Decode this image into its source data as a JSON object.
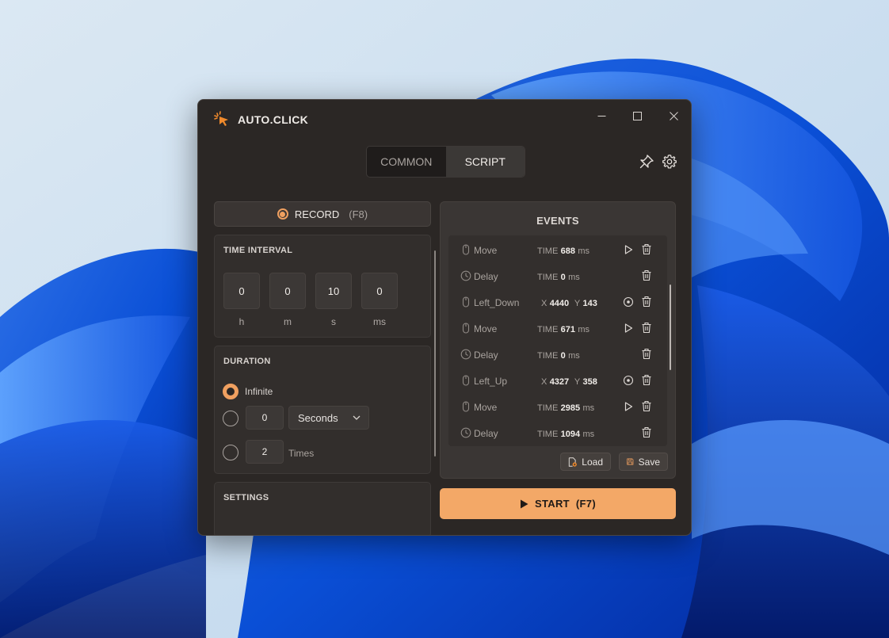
{
  "app": {
    "title": "AUTO.CLICK"
  },
  "tabs": [
    {
      "label": "COMMON",
      "active": false
    },
    {
      "label": "SCRIPT",
      "active": true
    }
  ],
  "record": {
    "label": "RECORD",
    "hotkey": "(F8)"
  },
  "time_interval": {
    "title": "TIME INTERVAL",
    "fields": [
      {
        "value": "0",
        "unit": "h"
      },
      {
        "value": "0",
        "unit": "m"
      },
      {
        "value": "10",
        "unit": "s"
      },
      {
        "value": "0",
        "unit": "ms"
      }
    ]
  },
  "duration": {
    "title": "DURATION",
    "selected": "infinite",
    "infinite_label": "Infinite",
    "seconds_value": "0",
    "seconds_unit": "Seconds",
    "times_value": "2",
    "times_label": "Times"
  },
  "settings": {
    "title": "SETTINGS"
  },
  "events": {
    "title": "EVENTS",
    "rows": [
      {
        "type": "mouse",
        "name": "Move",
        "kind": "time",
        "time": "688",
        "unit": "ms",
        "action": "play"
      },
      {
        "type": "clock",
        "name": "Delay",
        "kind": "time",
        "time": "0",
        "unit": "ms",
        "action": "none"
      },
      {
        "type": "mouse",
        "name": "Left_Down",
        "kind": "xy",
        "x": "4440",
        "y": "143",
        "action": "target"
      },
      {
        "type": "mouse",
        "name": "Move",
        "kind": "time",
        "time": "671",
        "unit": "ms",
        "action": "play"
      },
      {
        "type": "clock",
        "name": "Delay",
        "kind": "time",
        "time": "0",
        "unit": "ms",
        "action": "none"
      },
      {
        "type": "mouse",
        "name": "Left_Up",
        "kind": "xy",
        "x": "4327",
        "y": "358",
        "action": "target"
      },
      {
        "type": "mouse",
        "name": "Move",
        "kind": "time",
        "time": "2985",
        "unit": "ms",
        "action": "play"
      },
      {
        "type": "clock",
        "name": "Delay",
        "kind": "time",
        "time": "1094",
        "unit": "ms",
        "action": "none"
      }
    ],
    "labels": {
      "time": "TIME",
      "x": "X",
      "y": "Y"
    },
    "load_label": "Load",
    "save_label": "Save"
  },
  "start": {
    "label": "START",
    "hotkey": "(F7)"
  },
  "colors": {
    "accent": "#f3a867",
    "window_bg": "#2b2725",
    "panel_bg": "#322e2c"
  }
}
